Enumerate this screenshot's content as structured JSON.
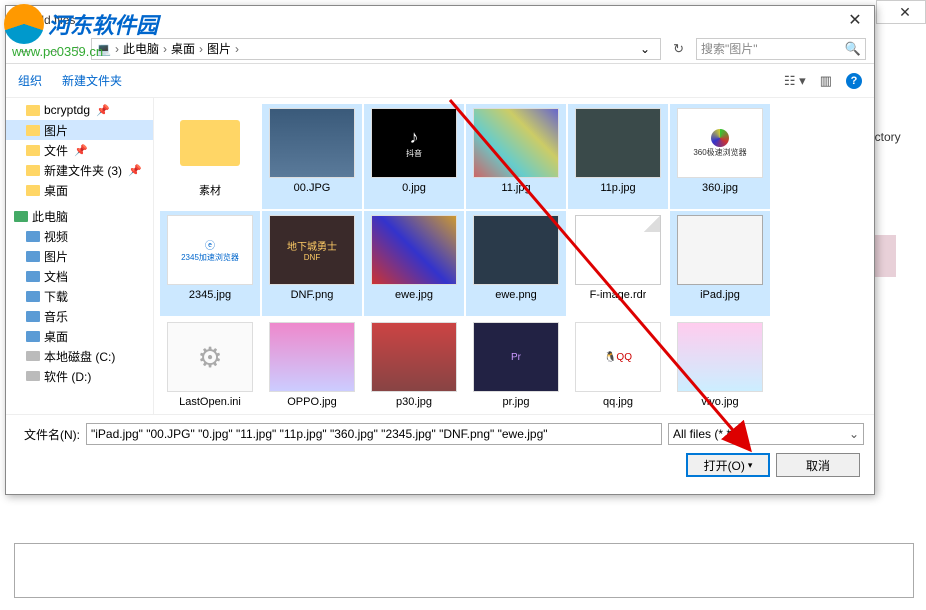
{
  "dialog": {
    "title": "Add files",
    "breadcrumb": {
      "root": "此电脑",
      "p1": "桌面",
      "p2": "图片"
    },
    "search_placeholder": "搜索\"图片\"",
    "toolbar": {
      "organize": "组织",
      "newfolder": "新建文件夹"
    },
    "filename_label": "文件名(N):",
    "filename_value": "\"iPad.jpg\" \"00.JPG\" \"0.jpg\" \"11.jpg\" \"11p.jpg\" \"360.jpg\" \"2345.jpg\" \"DNF.png\" \"ewe.jpg\"",
    "filter": "All files (*.*)",
    "open_btn": "打开(O)",
    "cancel_btn": "取消"
  },
  "sidebar": [
    {
      "label": "bcryptdg",
      "icon": "folder",
      "pin": true
    },
    {
      "label": "图片",
      "icon": "folder",
      "selected": true
    },
    {
      "label": "文件",
      "icon": "folder",
      "pin": true
    },
    {
      "label": "新建文件夹 (3)",
      "icon": "folder",
      "pin": true
    },
    {
      "label": "桌面",
      "icon": "folder"
    },
    {
      "label": "此电脑",
      "icon": "pc",
      "section": true
    },
    {
      "label": "视频",
      "icon": "blue"
    },
    {
      "label": "图片",
      "icon": "blue"
    },
    {
      "label": "文档",
      "icon": "blue"
    },
    {
      "label": "下载",
      "icon": "blue"
    },
    {
      "label": "音乐",
      "icon": "blue"
    },
    {
      "label": "桌面",
      "icon": "blue"
    },
    {
      "label": "本地磁盘 (C:)",
      "icon": "disk"
    },
    {
      "label": "软件 (D:)",
      "icon": "disk"
    }
  ],
  "files": [
    {
      "name": "素材",
      "type": "folder",
      "selected": false
    },
    {
      "name": "00.JPG",
      "cls": "t00",
      "selected": true
    },
    {
      "name": "0.jpg",
      "cls": "t0",
      "glyph": "♪",
      "sub": "抖音",
      "selected": true
    },
    {
      "name": "11.jpg",
      "cls": "t11",
      "selected": true
    },
    {
      "name": "11p.jpg",
      "cls": "t11p",
      "selected": true
    },
    {
      "name": "360.jpg",
      "cls": "t360",
      "icon360": true,
      "sub": "360极速浏览器",
      "selected": true
    },
    {
      "name": "2345.jpg",
      "cls": "t2345",
      "glyph": "ⓔ",
      "sub": "2345加速浏览器",
      "selected": true
    },
    {
      "name": "DNF.png",
      "cls": "tdnf",
      "glyph": "地下城勇士",
      "sub": "DNF",
      "selected": true
    },
    {
      "name": "ewe.jpg",
      "cls": "tewe",
      "selected": true
    },
    {
      "name": "ewe.png",
      "cls": "tewp",
      "selected": true
    },
    {
      "name": "F-image.rdr",
      "type": "doc",
      "selected": false
    },
    {
      "name": "iPad.jpg",
      "cls": "tipad",
      "selected": true
    },
    {
      "name": "LastOpen.ini",
      "cls": "tgear",
      "glyph": "⚙",
      "selected": false
    },
    {
      "name": "OPPO.jpg",
      "cls": "toppo",
      "selected": false
    },
    {
      "name": "p30.jpg",
      "cls": "tp30",
      "selected": false
    },
    {
      "name": "pr.jpg",
      "cls": "tprm",
      "glyph": "Pr",
      "selected": false
    },
    {
      "name": "qq.jpg",
      "cls": "tqq",
      "glyph": "🐧QQ",
      "selected": false
    },
    {
      "name": "vivo.jpg",
      "cls": "tvivo",
      "selected": false
    }
  ],
  "bg": {
    "rectory": "rectory"
  },
  "watermark": {
    "text": "河东软件园",
    "url": "www.pc0359.cn"
  }
}
